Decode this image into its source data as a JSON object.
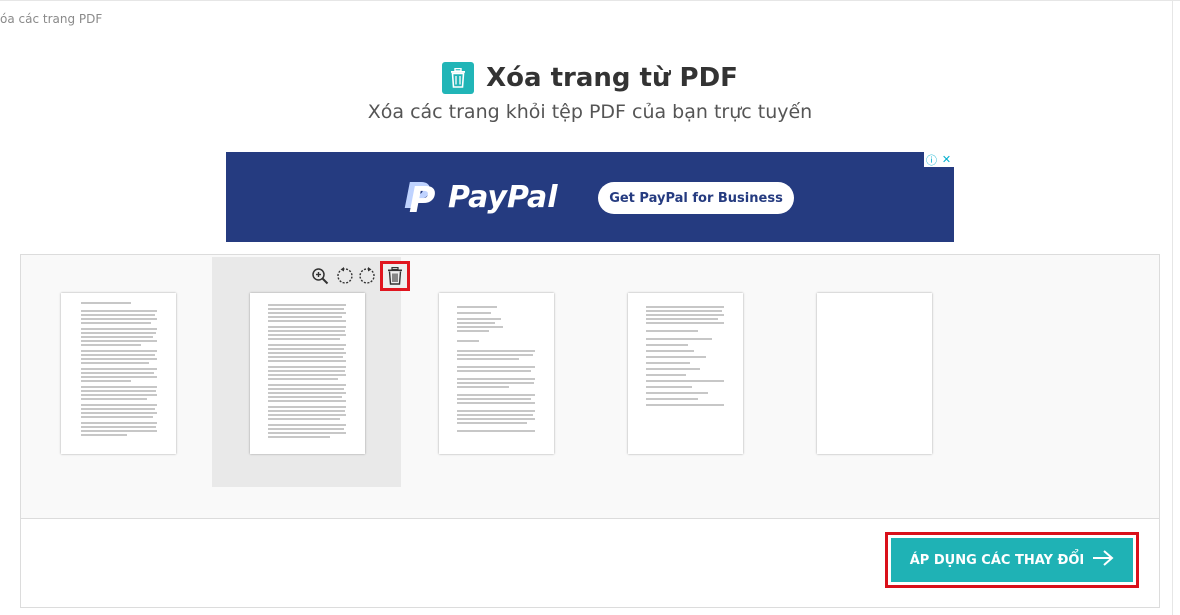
{
  "breadcrumb": "óa các trang PDF",
  "header": {
    "title": "Xóa trang từ PDF",
    "subtitle": "Xóa các trang khỏi tệp PDF của bạn trực tuyến",
    "icon": "trash-icon",
    "accent_color": "#21b5b7"
  },
  "ad": {
    "brand": "PayPal",
    "cta": "Get PayPal for Business",
    "background": "#253b80",
    "info_icon": "info-icon",
    "close_icon": "close-icon",
    "info_glyph": "ⓘ",
    "close_glyph": "✕"
  },
  "page_tools": {
    "zoom": "zoom-in-icon",
    "rotate_left": "rotate-left-icon",
    "rotate_right": "rotate-right-icon",
    "delete": "trash-icon"
  },
  "pages": [
    {
      "id": 1,
      "density": "full"
    },
    {
      "id": 2,
      "density": "full",
      "hovered": true
    },
    {
      "id": 3,
      "density": "medium"
    },
    {
      "id": 4,
      "density": "list"
    },
    {
      "id": 5,
      "density": "blank"
    }
  ],
  "apply_button": {
    "label": "ÁP DỤNG CÁC THAY ĐỔI",
    "arrow_icon": "arrow-right-icon",
    "color": "#1fb2b5",
    "highlight_color": "#d9101a"
  }
}
